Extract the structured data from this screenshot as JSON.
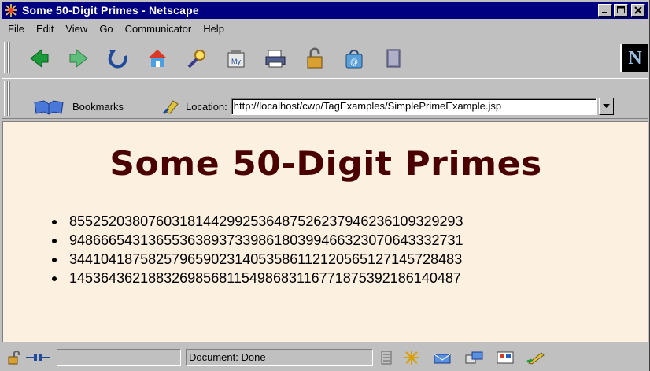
{
  "window": {
    "title": "Some 50-Digit Primes - Netscape",
    "controls": [
      "minimize-icon",
      "maximize-icon",
      "close-icon"
    ]
  },
  "menu": [
    {
      "label": "File"
    },
    {
      "label": "Edit"
    },
    {
      "label": "View"
    },
    {
      "label": "Go"
    },
    {
      "label": "Communicator"
    },
    {
      "label": "Help"
    }
  ],
  "nav_toolbar": {
    "icons": [
      "back-icon",
      "forward-icon",
      "reload-icon",
      "home-icon",
      "search-icon",
      "my-netscape-icon",
      "print-icon",
      "security-icon",
      "shop-icon",
      "stop-icon"
    ],
    "logo": "N"
  },
  "location_toolbar": {
    "bookmarks_label": "Bookmarks",
    "location_label": "Location:",
    "url": "http://localhost/cwp/TagExamples/SimplePrimeExample.jsp"
  },
  "content": {
    "heading": "Some 50-Digit Primes",
    "primes": [
      "85525203807603181442992536487526237946236109329293",
      "94866654313655363893733986180399466323070643332731",
      "34410418758257965902314053586112120565127145728483",
      "14536436218832698568115498683116771875392186140487"
    ],
    "background_color": "#fcf0e0",
    "heading_color": "#4a0000"
  },
  "statusbar": {
    "status": "Document: Done",
    "tray_icons": [
      "component-bar-icon",
      "navigator-icon",
      "mail-icon",
      "discussion-icon",
      "composer-icon",
      "edit-icon"
    ]
  }
}
